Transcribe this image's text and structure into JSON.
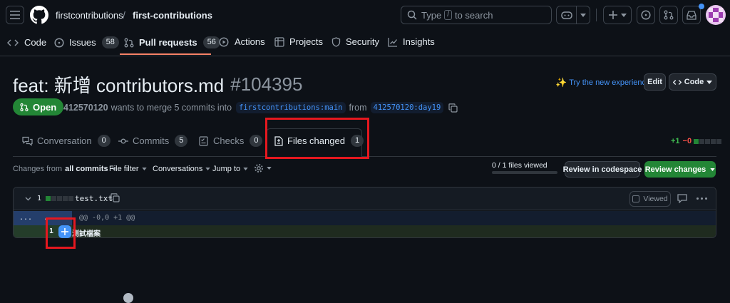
{
  "header": {
    "owner": "firstcontributions",
    "separator": "/",
    "repo": "first-contributions",
    "search_prefix": "Type",
    "search_key": "/",
    "search_suffix": "to search"
  },
  "nav": {
    "code": "Code",
    "issues": "Issues",
    "issues_count": "58",
    "pulls": "Pull requests",
    "pulls_count": "56",
    "actions": "Actions",
    "projects": "Projects",
    "security": "Security",
    "insights": "Insights"
  },
  "pr": {
    "title": "feat: 新增 contributors.md",
    "number": "#104395",
    "try_new": "Try the new experience",
    "edit": "Edit",
    "code_btn": "Code",
    "state": "Open",
    "author": "412570120",
    "merge_text": "wants to merge 5 commits into",
    "base": "firstcontributions:main",
    "from": "from",
    "head": "412570120:day19"
  },
  "tabs": {
    "conversation": "Conversation",
    "conversation_count": "0",
    "commits": "Commits",
    "commits_count": "5",
    "checks": "Checks",
    "checks_count": "0",
    "files": "Files changed",
    "files_count": "1",
    "additions": "+1",
    "deletions": "−0"
  },
  "toolbar": {
    "changes_from": "Changes from",
    "all_commits": "all commits",
    "file_filter": "File filter",
    "conversations": "Conversations",
    "jump_to": "Jump to",
    "files_viewed": "0 / 1 files viewed",
    "review_codespace": "Review in codespace",
    "review_changes": "Review changes"
  },
  "file": {
    "change_count": "1",
    "name": "test.txt",
    "viewed": "Viewed",
    "hunk_left": "...",
    "hunk_right": "...",
    "hunk_header": "@@ -0,0 +1 @@",
    "line_number": "1",
    "line_text": "測試檔案"
  },
  "colors": {
    "accent": "#1f6feb",
    "green": "#238636",
    "highlight": "#e5181f"
  }
}
